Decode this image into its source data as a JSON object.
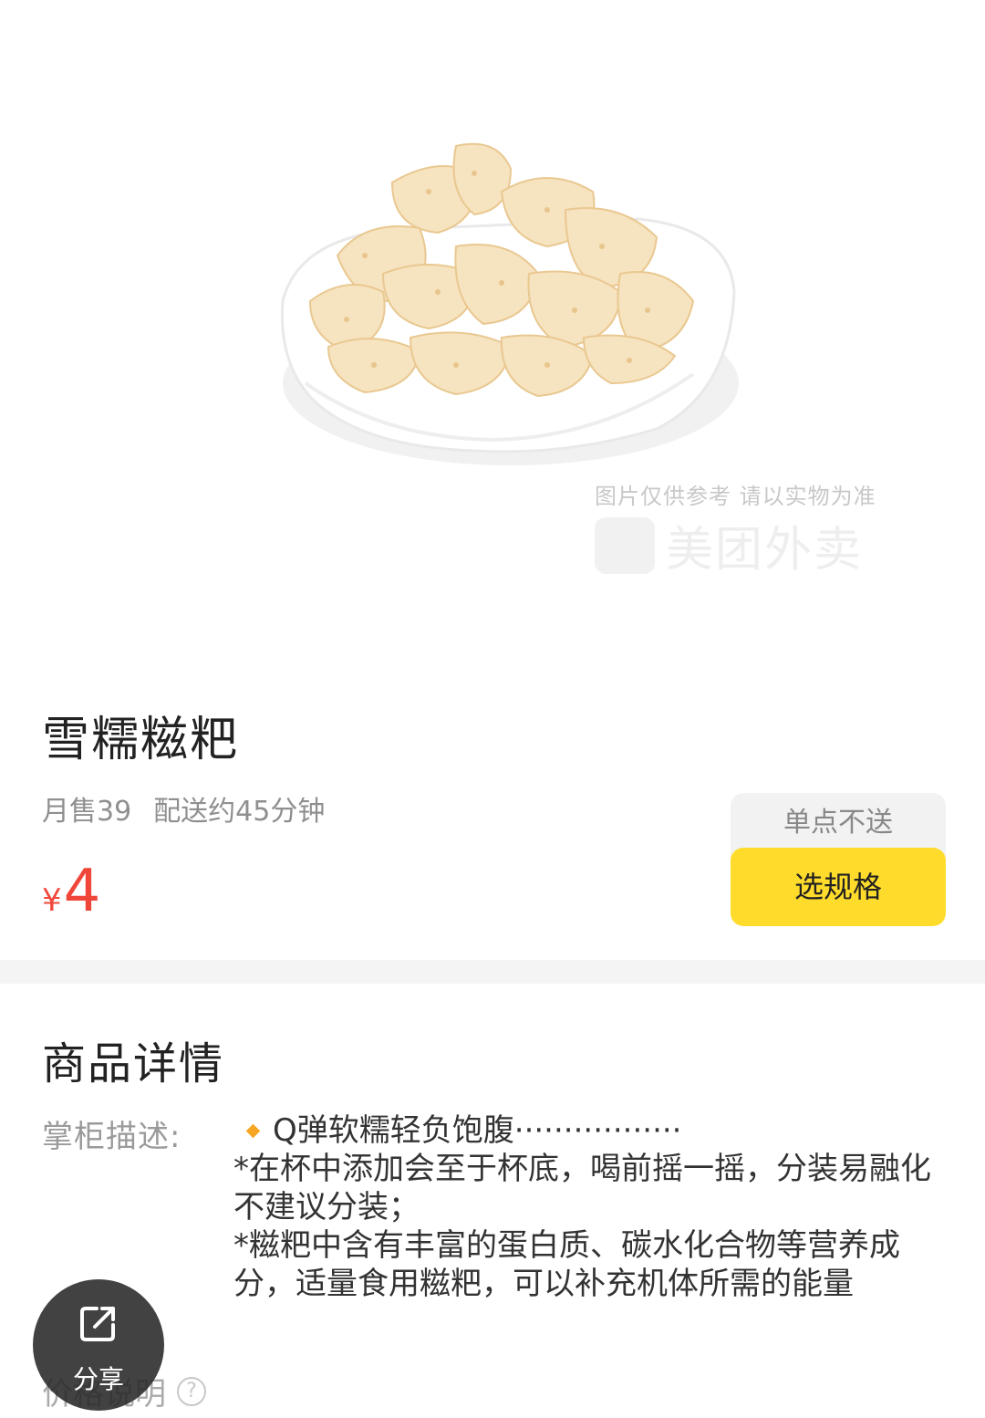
{
  "product": {
    "name": "雪糯糍粑",
    "monthly_sales": "月售39",
    "delivery": "配送约45分钟",
    "currency": "¥",
    "price": "4"
  },
  "image": {
    "watermark_note": "图片仅供参考 请以实物为准",
    "watermark_brand": "美团外卖"
  },
  "actions": {
    "single_note": "单点不送",
    "select_spec_label": "选规格"
  },
  "details": {
    "title": "商品详情",
    "desc_label": "掌柜描述:",
    "bullet_line": "Q弹软糯轻负饱腹·················",
    "para_1": "*在杯中添加会至于杯底，喝前摇一摇，分装易融化不建议分装；",
    "para_2": "*糍粑中含有丰富的蛋白质、碳水化合物等营养成分，适量食用糍粑，可以补充机体所需的能量",
    "price_note": "价格说明"
  },
  "share": {
    "label": "分享"
  },
  "colors": {
    "price": "#f0463a",
    "button": "#ffdc2b",
    "bullet": "#f5a623"
  }
}
